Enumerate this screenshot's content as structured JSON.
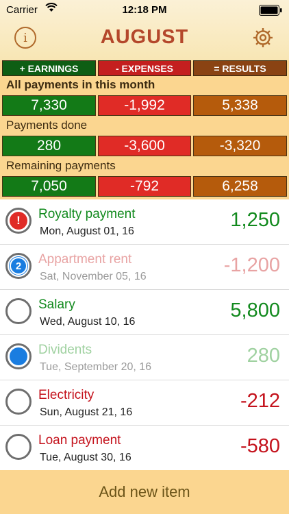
{
  "status_bar": {
    "carrier": "Carrier",
    "time": "12:18 PM"
  },
  "header": {
    "title": "AUGUST",
    "info_glyph": "i"
  },
  "summary": {
    "headers": {
      "earnings": "+ EARNINGS",
      "expenses": "- EXPENSES",
      "results": "= RESULTS"
    },
    "sections": [
      {
        "label": "All payments in this month",
        "earnings": "7,330",
        "expenses": "-1,992",
        "results": "5,338"
      },
      {
        "label": "Payments done",
        "earnings": "280",
        "expenses": "-3,600",
        "results": "-3,320"
      },
      {
        "label": "Remaining payments",
        "earnings": "7,050",
        "expenses": "-792",
        "results": "6,258"
      }
    ]
  },
  "items": [
    {
      "name": "Royalty payment",
      "date": "Mon, August 01, 16",
      "amount": "1,250",
      "status": "alert",
      "badge": "!"
    },
    {
      "name": "Appartment rent",
      "date": "Sat, November 05, 16",
      "amount": "-1,200",
      "status": "count",
      "badge": "2"
    },
    {
      "name": "Salary",
      "date": "Wed, August 10, 16",
      "amount": "5,800",
      "status": "empty",
      "badge": ""
    },
    {
      "name": "Dividents",
      "date": "Tue, September 20, 16",
      "amount": "280",
      "status": "done",
      "badge": ""
    },
    {
      "name": "Electricity",
      "date": "Sun, August 21, 16",
      "amount": "-212",
      "status": "empty",
      "badge": ""
    },
    {
      "name": "Loan payment",
      "date": "Tue, August 30, 16",
      "amount": "-580",
      "status": "empty",
      "badge": ""
    }
  ],
  "footer": {
    "add_label": "Add new item"
  },
  "colors": {
    "title": "#b4472b",
    "earnings_green": "#137a17",
    "expenses_red": "#e02b26",
    "results_brown": "#b55b0c",
    "header_earnings": "#0e5e14",
    "header_expenses": "#c41f1f",
    "header_results": "#8a4313",
    "income_text": "#128a1e",
    "expense_text": "#c4121c",
    "income_faded": "#9fd1a0",
    "expense_faded": "#e8a3a3",
    "accent_blue": "#1a7de0"
  }
}
